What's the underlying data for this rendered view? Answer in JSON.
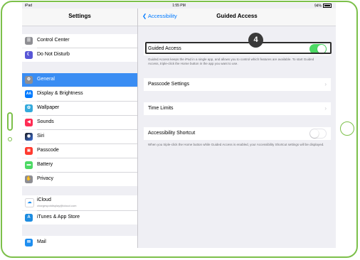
{
  "statusbar": {
    "left": "iPad",
    "time": "1:55 PM",
    "battery": "94%"
  },
  "sidebar": {
    "title": "Settings",
    "items": [
      {
        "label": "Control Center",
        "icon": "control-center-icon",
        "color": "#8e8e93",
        "glyph": "☰"
      },
      {
        "label": "Do Not Disturb",
        "icon": "moon-icon",
        "color": "#5856d6",
        "glyph": "☾"
      },
      {
        "label": "General",
        "icon": "gear-icon",
        "color": "#8e8e93",
        "glyph": "⚙"
      },
      {
        "label": "Display & Brightness",
        "icon": "brightness-icon",
        "color": "#007aff",
        "glyph": "AA"
      },
      {
        "label": "Wallpaper",
        "icon": "wallpaper-icon",
        "color": "#35aadc",
        "glyph": "✿"
      },
      {
        "label": "Sounds",
        "icon": "speaker-icon",
        "color": "#ff2d55",
        "glyph": "◀"
      },
      {
        "label": "Siri",
        "icon": "siri-icon",
        "color": "#1c1c1e",
        "glyph": "◉"
      },
      {
        "label": "Passcode",
        "icon": "lock-icon",
        "color": "#ff3b30",
        "glyph": "🔒"
      },
      {
        "label": "Battery",
        "icon": "battery-icon",
        "color": "#4cd964",
        "glyph": "▬"
      },
      {
        "label": "Privacy",
        "icon": "hand-icon",
        "color": "#8e8e93",
        "glyph": "✋"
      },
      {
        "label": "iCloud",
        "sublabel": "chargespotdisplay@icloud.com",
        "icon": "cloud-icon",
        "color": "#ffffff",
        "glyph": "☁"
      },
      {
        "label": "iTunes & App Store",
        "icon": "app-store-icon",
        "color": "#1d8ce0",
        "glyph": "A"
      },
      {
        "label": "Mail",
        "icon": "mail-icon",
        "color": "#1e8ef0",
        "glyph": "✉"
      }
    ]
  },
  "detail": {
    "back_label": "Accessibility",
    "title": "Guided Access",
    "guided_access_label": "Guided Access",
    "guided_access_on": true,
    "guided_access_desc": "Guided Access keeps the iPad in a single app, and allows you to control which features are available. To start Guided Access, triple-click the Home button in the app you want to use.",
    "passcode_settings_label": "Passcode Settings",
    "time_limits_label": "Time Limits",
    "accessibility_shortcut_label": "Accessibility Shortcut",
    "accessibility_shortcut_on": false,
    "shortcut_desc": "When you triple-click the Home button while Guided Access is enabled, your Accessibility Shortcut settings will be displayed."
  },
  "annotation": {
    "step_number": "4"
  },
  "colors": {
    "accent": "#7cc04a",
    "selected": "#3a8df3",
    "toggle_on": "#4cd964",
    "link": "#007aff"
  }
}
